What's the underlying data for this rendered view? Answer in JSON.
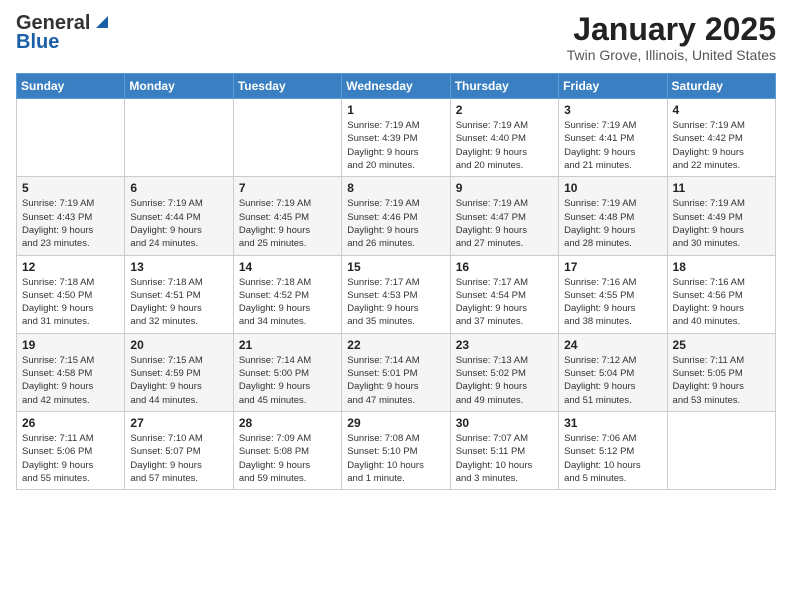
{
  "header": {
    "logo_general": "General",
    "logo_blue": "Blue",
    "month": "January 2025",
    "location": "Twin Grove, Illinois, United States"
  },
  "weekdays": [
    "Sunday",
    "Monday",
    "Tuesday",
    "Wednesday",
    "Thursday",
    "Friday",
    "Saturday"
  ],
  "weeks": [
    [
      {
        "day": "",
        "info": ""
      },
      {
        "day": "",
        "info": ""
      },
      {
        "day": "",
        "info": ""
      },
      {
        "day": "1",
        "info": "Sunrise: 7:19 AM\nSunset: 4:39 PM\nDaylight: 9 hours\nand 20 minutes."
      },
      {
        "day": "2",
        "info": "Sunrise: 7:19 AM\nSunset: 4:40 PM\nDaylight: 9 hours\nand 20 minutes."
      },
      {
        "day": "3",
        "info": "Sunrise: 7:19 AM\nSunset: 4:41 PM\nDaylight: 9 hours\nand 21 minutes."
      },
      {
        "day": "4",
        "info": "Sunrise: 7:19 AM\nSunset: 4:42 PM\nDaylight: 9 hours\nand 22 minutes."
      }
    ],
    [
      {
        "day": "5",
        "info": "Sunrise: 7:19 AM\nSunset: 4:43 PM\nDaylight: 9 hours\nand 23 minutes."
      },
      {
        "day": "6",
        "info": "Sunrise: 7:19 AM\nSunset: 4:44 PM\nDaylight: 9 hours\nand 24 minutes."
      },
      {
        "day": "7",
        "info": "Sunrise: 7:19 AM\nSunset: 4:45 PM\nDaylight: 9 hours\nand 25 minutes."
      },
      {
        "day": "8",
        "info": "Sunrise: 7:19 AM\nSunset: 4:46 PM\nDaylight: 9 hours\nand 26 minutes."
      },
      {
        "day": "9",
        "info": "Sunrise: 7:19 AM\nSunset: 4:47 PM\nDaylight: 9 hours\nand 27 minutes."
      },
      {
        "day": "10",
        "info": "Sunrise: 7:19 AM\nSunset: 4:48 PM\nDaylight: 9 hours\nand 28 minutes."
      },
      {
        "day": "11",
        "info": "Sunrise: 7:19 AM\nSunset: 4:49 PM\nDaylight: 9 hours\nand 30 minutes."
      }
    ],
    [
      {
        "day": "12",
        "info": "Sunrise: 7:18 AM\nSunset: 4:50 PM\nDaylight: 9 hours\nand 31 minutes."
      },
      {
        "day": "13",
        "info": "Sunrise: 7:18 AM\nSunset: 4:51 PM\nDaylight: 9 hours\nand 32 minutes."
      },
      {
        "day": "14",
        "info": "Sunrise: 7:18 AM\nSunset: 4:52 PM\nDaylight: 9 hours\nand 34 minutes."
      },
      {
        "day": "15",
        "info": "Sunrise: 7:17 AM\nSunset: 4:53 PM\nDaylight: 9 hours\nand 35 minutes."
      },
      {
        "day": "16",
        "info": "Sunrise: 7:17 AM\nSunset: 4:54 PM\nDaylight: 9 hours\nand 37 minutes."
      },
      {
        "day": "17",
        "info": "Sunrise: 7:16 AM\nSunset: 4:55 PM\nDaylight: 9 hours\nand 38 minutes."
      },
      {
        "day": "18",
        "info": "Sunrise: 7:16 AM\nSunset: 4:56 PM\nDaylight: 9 hours\nand 40 minutes."
      }
    ],
    [
      {
        "day": "19",
        "info": "Sunrise: 7:15 AM\nSunset: 4:58 PM\nDaylight: 9 hours\nand 42 minutes."
      },
      {
        "day": "20",
        "info": "Sunrise: 7:15 AM\nSunset: 4:59 PM\nDaylight: 9 hours\nand 44 minutes."
      },
      {
        "day": "21",
        "info": "Sunrise: 7:14 AM\nSunset: 5:00 PM\nDaylight: 9 hours\nand 45 minutes."
      },
      {
        "day": "22",
        "info": "Sunrise: 7:14 AM\nSunset: 5:01 PM\nDaylight: 9 hours\nand 47 minutes."
      },
      {
        "day": "23",
        "info": "Sunrise: 7:13 AM\nSunset: 5:02 PM\nDaylight: 9 hours\nand 49 minutes."
      },
      {
        "day": "24",
        "info": "Sunrise: 7:12 AM\nSunset: 5:04 PM\nDaylight: 9 hours\nand 51 minutes."
      },
      {
        "day": "25",
        "info": "Sunrise: 7:11 AM\nSunset: 5:05 PM\nDaylight: 9 hours\nand 53 minutes."
      }
    ],
    [
      {
        "day": "26",
        "info": "Sunrise: 7:11 AM\nSunset: 5:06 PM\nDaylight: 9 hours\nand 55 minutes."
      },
      {
        "day": "27",
        "info": "Sunrise: 7:10 AM\nSunset: 5:07 PM\nDaylight: 9 hours\nand 57 minutes."
      },
      {
        "day": "28",
        "info": "Sunrise: 7:09 AM\nSunset: 5:08 PM\nDaylight: 9 hours\nand 59 minutes."
      },
      {
        "day": "29",
        "info": "Sunrise: 7:08 AM\nSunset: 5:10 PM\nDaylight: 10 hours\nand 1 minute."
      },
      {
        "day": "30",
        "info": "Sunrise: 7:07 AM\nSunset: 5:11 PM\nDaylight: 10 hours\nand 3 minutes."
      },
      {
        "day": "31",
        "info": "Sunrise: 7:06 AM\nSunset: 5:12 PM\nDaylight: 10 hours\nand 5 minutes."
      },
      {
        "day": "",
        "info": ""
      }
    ]
  ]
}
